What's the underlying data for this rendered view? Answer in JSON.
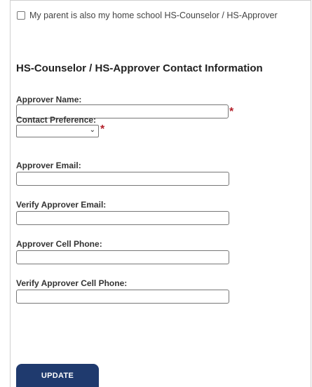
{
  "checkbox": {
    "label": "My parent is also my home school HS-Counselor / HS-Approver",
    "checked": false
  },
  "section_title": "HS-Counselor / HS-Approver Contact Information",
  "fields": {
    "approver_name": {
      "label": "Approver Name:",
      "value": "",
      "required_mark": "*"
    },
    "contact_preference": {
      "label": "Contact Preference:",
      "selected": "",
      "required_mark": "*"
    },
    "approver_email": {
      "label": "Approver Email:",
      "value": ""
    },
    "verify_approver_email": {
      "label": "Verify Approver Email:",
      "value": ""
    },
    "approver_cell_phone": {
      "label": "Approver Cell Phone:",
      "value": ""
    },
    "verify_approver_cell_phone": {
      "label": "Verify Approver Cell Phone:",
      "value": ""
    }
  },
  "buttons": {
    "update_label": "UPDATE"
  },
  "colors": {
    "button_bg": "#1f3a6e",
    "required": "#b3202a"
  }
}
